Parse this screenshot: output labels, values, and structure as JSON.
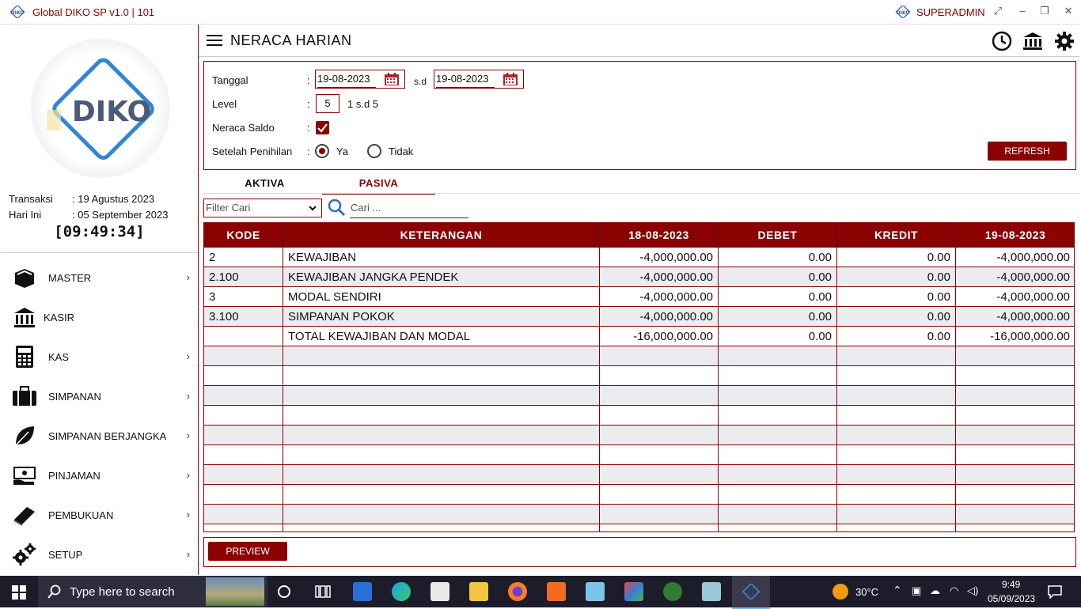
{
  "window": {
    "title": "Global DIKO SP v1.0 | 101",
    "user": "SUPERADMIN",
    "logo_text": "DIKO"
  },
  "sidebar": {
    "transaksi_label": "Transaksi",
    "transaksi_value": ": 19 Agustus 2023",
    "hari_ini_label": "Hari Ini",
    "hari_ini_value": ": 05 September 2023",
    "clock": "[09:49:34]",
    "menu": [
      {
        "label": "MASTER",
        "icon": "box-icon",
        "has_submenu": true
      },
      {
        "label": "KASIR",
        "icon": "bank-icon",
        "has_submenu": false
      },
      {
        "label": "KAS",
        "icon": "calculator-icon",
        "has_submenu": true
      },
      {
        "label": "SIMPANAN",
        "icon": "briefcase-icon",
        "has_submenu": true
      },
      {
        "label": "SIMPANAN BERJANGKA",
        "icon": "leaf-icon",
        "has_submenu": true
      },
      {
        "label": "PINJAMAN",
        "icon": "money-hand-icon",
        "has_submenu": true
      },
      {
        "label": "PEMBUKUAN",
        "icon": "book-icon",
        "has_submenu": true
      },
      {
        "label": "SETUP",
        "icon": "gears-icon",
        "has_submenu": true
      }
    ]
  },
  "header": {
    "title": "NERACA HARIAN"
  },
  "form": {
    "tanggal_label": "Tanggal",
    "colon": ":",
    "date_from": "19-08-2023",
    "sd_label": "s.d",
    "date_to": "19-08-2023",
    "level_label": "Level",
    "level_value": "5",
    "level_hint": "1 s.d 5",
    "neraca_saldo_label": "Neraca Saldo",
    "neraca_saldo_checked": true,
    "penihilan_label": "Setelah Penihilan",
    "radio_ya": "Ya",
    "radio_tidak": "Tidak",
    "selected": "Ya",
    "refresh_label": "REFRESH"
  },
  "tabs": [
    {
      "label": "AKTIVA",
      "active": false
    },
    {
      "label": "PASIVA",
      "active": true
    }
  ],
  "filter": {
    "filter_placeholder": "Filter Cari",
    "search_placeholder": "Cari ..."
  },
  "table": {
    "columns": [
      "KODE",
      "KETERANGAN",
      "18-08-2023",
      "DEBET",
      "KREDIT",
      "19-08-2023"
    ],
    "rows": [
      [
        "2",
        "KEWAJIBAN",
        "-4,000,000.00",
        "0.00",
        "0.00",
        "-4,000,000.00"
      ],
      [
        "2.100",
        "KEWAJIBAN JANGKA PENDEK",
        "-4,000,000.00",
        "0.00",
        "0.00",
        "-4,000,000.00"
      ],
      [
        "3",
        "MODAL SENDIRI",
        "-4,000,000.00",
        "0.00",
        "0.00",
        "-4,000,000.00"
      ],
      [
        "3.100",
        "SIMPANAN POKOK",
        "-4,000,000.00",
        "0.00",
        "0.00",
        "-4,000,000.00"
      ],
      [
        "",
        "TOTAL KEWAJIBAN DAN MODAL",
        "-16,000,000.00",
        "0.00",
        "0.00",
        "-16,000,000.00"
      ]
    ],
    "empty_rows": 10
  },
  "footer": {
    "preview_label": "PREVIEW"
  },
  "taskbar": {
    "search_placeholder": "Type here to search",
    "temperature": "30°C",
    "time": "9:49",
    "date": "05/09/2023"
  },
  "colors": {
    "accent": "#8b0000",
    "taskbar": "#1c1c2a"
  }
}
